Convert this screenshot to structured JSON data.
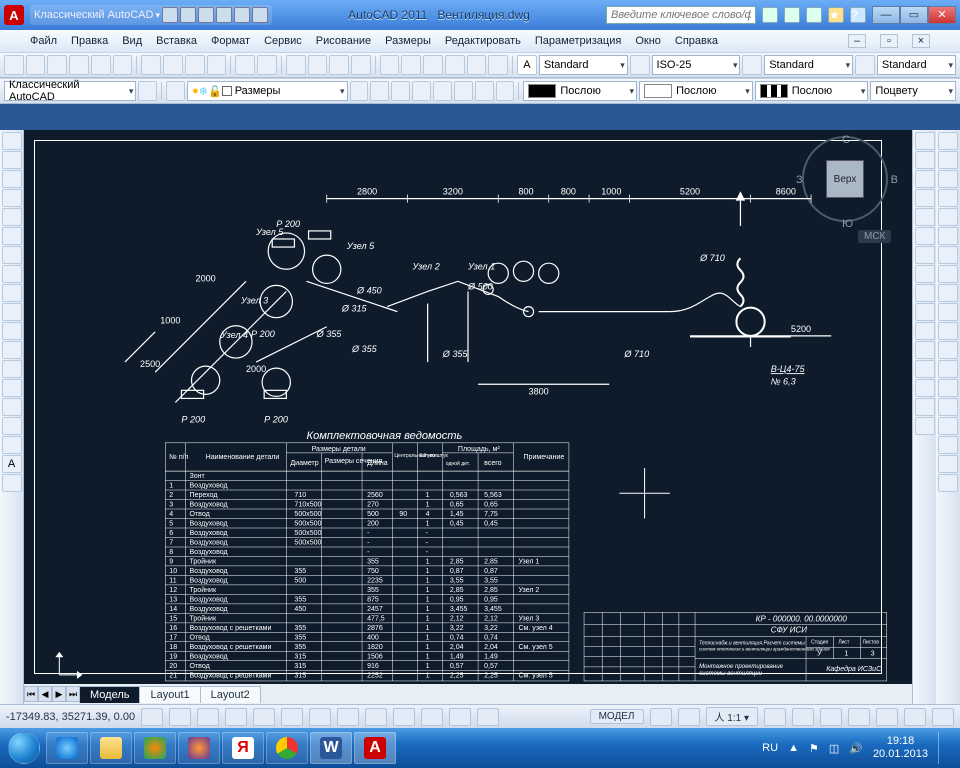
{
  "title": {
    "app": "AutoCAD 2011",
    "file": "Вентиляция.dwg",
    "workspace": "Классический AutoCAD"
  },
  "search": {
    "placeholder": "Введите ключевое слово/фразу"
  },
  "menu": [
    "Файл",
    "Правка",
    "Вид",
    "Вставка",
    "Формат",
    "Сервис",
    "Рисование",
    "Размеры",
    "Редактировать",
    "Параметризация",
    "Окно",
    "Справка"
  ],
  "styles": {
    "text": "Standard",
    "dim": "ISO-25",
    "tbl": "Standard",
    "ml": "Standard"
  },
  "row2": {
    "workspace": "Классический AutoCAD",
    "layer": "Размеры"
  },
  "props": {
    "color": "Послою",
    "ltype": "Послою",
    "lweight": "Послою",
    "plot": "Поцвету"
  },
  "viewcube": {
    "face": "Верх",
    "n": "С",
    "e": "В",
    "s": "Ю",
    "w": "З",
    "msk": "МСК"
  },
  "tabs": {
    "model": "Модель",
    "l1": "Layout1",
    "l2": "Layout2"
  },
  "status": {
    "coords": "-17349.83, 35271.39, 0.00",
    "model": "МОДЕЛ",
    "scale": "1:1",
    "ann": "人"
  },
  "tray": {
    "lang": "RU",
    "time": "19:18",
    "date": "20.01.2013"
  },
  "drawing": {
    "dims": [
      "2800",
      "3200",
      "800",
      "800",
      "1000",
      "5200",
      "8600",
      "5200",
      "3800",
      "2000",
      "1000",
      "2500",
      "2000"
    ],
    "labels": [
      "Узел 1",
      "Узел 2",
      "Узел 3",
      "Узел 4",
      "Узел 5",
      "Узел 5"
    ],
    "p": [
      "Р 200",
      "Р 200",
      "Р 200",
      "Р 200"
    ],
    "dia": [
      "Ø 710",
      "Ø 710",
      "Ø 500",
      "Ø 450",
      "Ø 355",
      "Ø 355",
      "Ø 355",
      "Ø 315"
    ],
    "equip": "В-Ц4-75",
    "equip2": "№ 6,3",
    "nodes": [
      "1",
      "2",
      "3",
      "4",
      "5",
      "6",
      "7",
      "8",
      "9",
      "10",
      "11",
      "12",
      "13",
      "14",
      "15",
      "16",
      "17",
      "18",
      "19",
      "20",
      "21"
    ]
  },
  "table": {
    "title": "Комплектовочная ведомость",
    "head": {
      "no": "№ п/п",
      "name": "Наименование детали",
      "size": "Размеры детали",
      "dia": "Диаметр",
      "sec": "Размеры сечения",
      "len": "Длина",
      "ang": "Центральный угол",
      "qty": "Кол-во штук",
      "area": "Площадь, м²",
      "a1": "одной дет.",
      "a2": "всего",
      "note": "Примечание"
    },
    "rows": [
      {
        "n": "",
        "name": "Зонт"
      },
      {
        "n": "1",
        "name": "Воздуховод"
      },
      {
        "n": "2",
        "name": "Переход",
        "d": "710",
        "l": "2560",
        "q": "1",
        "a1": "0,563",
        "a2": "5,563"
      },
      {
        "n": "3",
        "name": "Воздуховод",
        "d": "710х500",
        "l": "270",
        "q": "1",
        "a1": "0,65",
        "a2": "0,65"
      },
      {
        "n": "4",
        "name": "Отвод",
        "d": "500х500",
        "l": "500",
        "ang": "90",
        "q": "4",
        "a1": "1,45",
        "a2": "7,75"
      },
      {
        "n": "5",
        "name": "Воздуховод",
        "d": "500х500",
        "l": "200",
        "q": "1",
        "a1": "0,45",
        "a2": "0,45"
      },
      {
        "n": "6",
        "name": "Воздуховод",
        "d": "500х500",
        "l": "-",
        "q": "-"
      },
      {
        "n": "7",
        "name": "Воздуховод",
        "d": "500х500",
        "l": "-",
        "q": "-"
      },
      {
        "n": "8",
        "name": "Воздуховод",
        "d": "",
        "l": "-",
        "q": "-"
      },
      {
        "n": "9",
        "name": "Тройник",
        "d": "",
        "l": "355",
        "q": "1",
        "a1": "2,85",
        "a2": "2,85",
        "note": "Узел 1"
      },
      {
        "n": "10",
        "name": "Воздуховод",
        "d": "355",
        "l": "750",
        "q": "1",
        "a1": "0,87",
        "a2": "0,87"
      },
      {
        "n": "11",
        "name": "Воздуховод",
        "d": "500",
        "l": "2235",
        "q": "1",
        "a1": "3,55",
        "a2": "3,55"
      },
      {
        "n": "12",
        "name": "Тройник",
        "d": "",
        "l": "355",
        "q": "1",
        "a1": "2,85",
        "a2": "2,85",
        "note": "Узел 2"
      },
      {
        "n": "13",
        "name": "Воздуховод",
        "d": "355",
        "l": "875",
        "q": "1",
        "a1": "0,95",
        "a2": "0,95"
      },
      {
        "n": "14",
        "name": "Воздуховод",
        "d": "450",
        "l": "2457",
        "q": "1",
        "a1": "3,455",
        "a2": "3,455"
      },
      {
        "n": "15",
        "name": "Тройник",
        "d": "",
        "l": "477,5",
        "q": "1",
        "a1": "2,12",
        "a2": "2,12",
        "note": "Узел 3"
      },
      {
        "n": "16",
        "name": "Воздуховод с решетками",
        "d": "355",
        "l": "2876",
        "q": "1",
        "a1": "3,22",
        "a2": "3,22",
        "note": "См. узел 4"
      },
      {
        "n": "17",
        "name": "Отвод",
        "d": "355",
        "l": "400",
        "q": "1",
        "a1": "0,74",
        "a2": "0,74"
      },
      {
        "n": "18",
        "name": "Воздуховод с решетками",
        "d": "355",
        "l": "1820",
        "q": "1",
        "a1": "2,04",
        "a2": "2,04",
        "note": "См. узел 5"
      },
      {
        "n": "19",
        "name": "Воздуховод",
        "d": "315",
        "l": "1506",
        "q": "1",
        "a1": "1,49",
        "a2": "1,49"
      },
      {
        "n": "20",
        "name": "Отвод",
        "d": "315",
        "l": "916",
        "q": "1",
        "a1": "0,57",
        "a2": "0,57"
      },
      {
        "n": "21",
        "name": "Воздуховод с решетками",
        "d": "315",
        "l": "2252",
        "q": "1",
        "a1": "2,25",
        "a2": "2,25",
        "note": "См. узел 5"
      }
    ]
  },
  "titleblock": {
    "code": "КР - 000000. 00.0000000",
    "org": "СФУ ИСИ",
    "line1": "Теплоснабж.и вентиляция.Расчет системы",
    "line2": "систем отопления и вентиляции гражданственного здания",
    "draw1": "Монтажное проектирование",
    "draw2": "системы вентиляции",
    "dept": "Кафедра ИСЗиС",
    "stage": "Стадия",
    "sheet": "Лист",
    "sheets": "Листов",
    "stv": "У",
    "sh": "1",
    "shs": "3"
  }
}
